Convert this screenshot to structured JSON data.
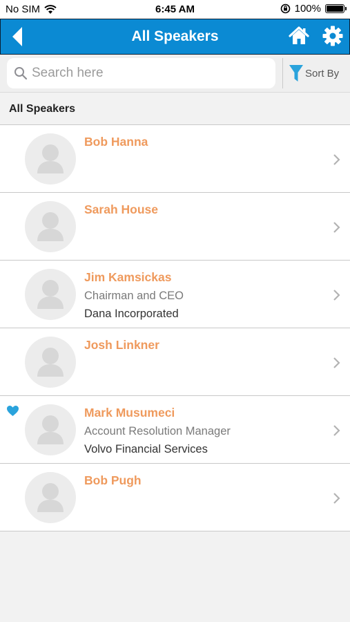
{
  "status_bar": {
    "carrier": "No SIM",
    "time": "6:45 AM",
    "battery": "100%"
  },
  "nav": {
    "title": "All Speakers"
  },
  "search": {
    "placeholder": "Search here"
  },
  "sort": {
    "label": "Sort By"
  },
  "section": {
    "title": "All Speakers"
  },
  "speakers": [
    {
      "name": "Bob Hanna",
      "role": "",
      "company": "",
      "favorite": false
    },
    {
      "name": "Sarah House",
      "role": "",
      "company": "",
      "favorite": false
    },
    {
      "name": "Jim Kamsickas",
      "role": "Chairman and CEO",
      "company": "Dana Incorporated",
      "favorite": false
    },
    {
      "name": "Josh Linkner",
      "role": "",
      "company": "",
      "favorite": false
    },
    {
      "name": "Mark Musumeci",
      "role": "Account Resolution Manager",
      "company": "Volvo Financial Services",
      "favorite": true
    },
    {
      "name": "Bob Pugh",
      "role": "",
      "company": "",
      "favorite": false
    }
  ],
  "colors": {
    "nav": "#0b8ad3",
    "name": "#ef9a5d",
    "accent": "#2aa3dc"
  },
  "icons": {
    "back": "chevron-left-icon",
    "home": "home-icon",
    "settings": "gear-icon",
    "search": "search-icon",
    "sort": "filter-icon",
    "favorite": "heart-icon",
    "row": "chevron-right-icon"
  }
}
